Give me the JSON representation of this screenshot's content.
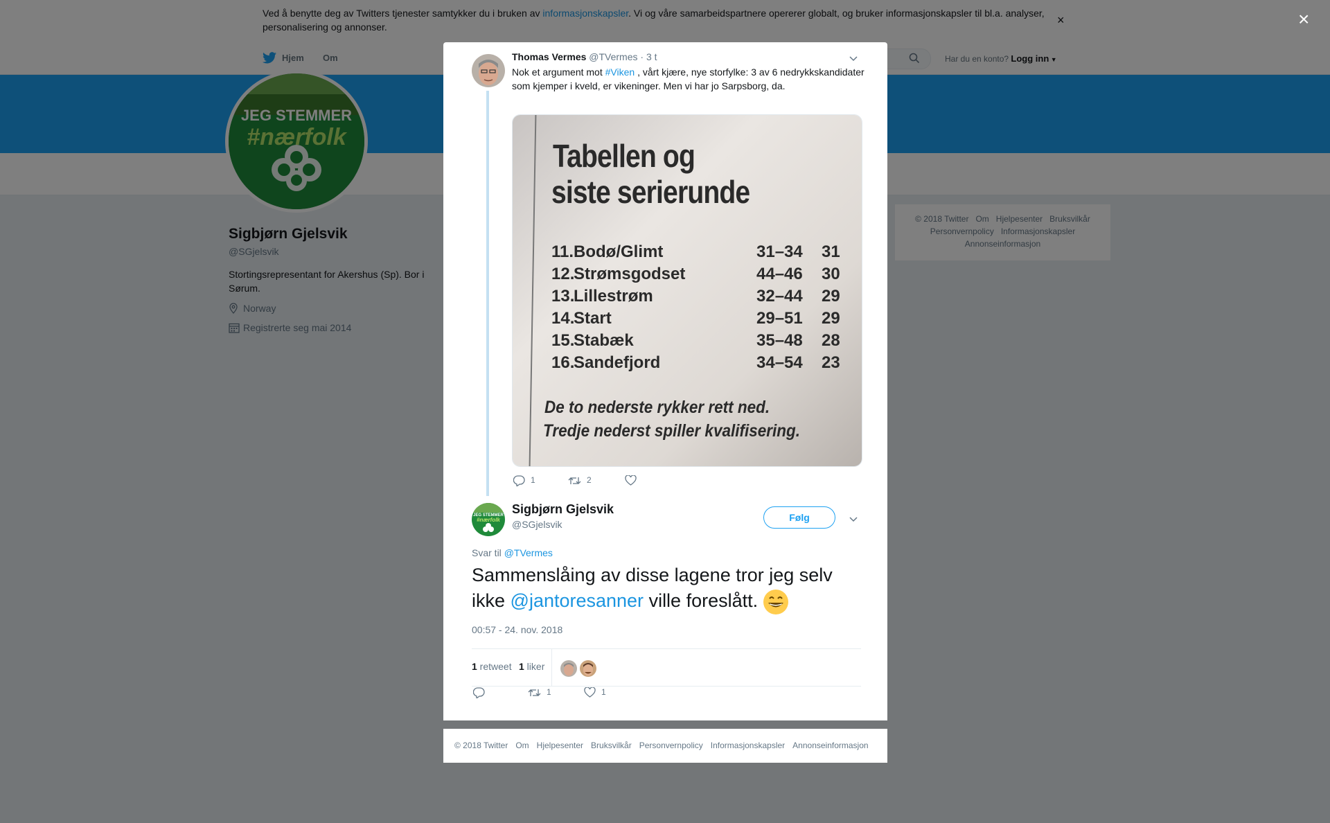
{
  "cookie_banner": {
    "text_before": "Ved å benytte deg av Twitters tjenester samtykker du i bruken av ",
    "link": "informasjonskapsler",
    "text_after": ". Vi og våre samarbeidspartnere opererer globalt, og bruker informasjonskapsler til bl.a. analyser, personalisering og annonser.",
    "close_label": "×"
  },
  "nav": {
    "home": "Hjem",
    "about": "Om",
    "login_prompt": "Har du en konto?",
    "login": "Logg inn"
  },
  "profile": {
    "name": "Sigbjørn Gjelsvik",
    "handle": "@SGjelsvik",
    "bio": "Stortingsrepresentant for Akershus (Sp). Bor i Sørum.",
    "location": "Norway",
    "joined": "Registrerte seg mai 2014",
    "avatar_text_1": "JEG STEMMER",
    "avatar_text_2": "#nærfolk"
  },
  "side_footer": {
    "items": [
      "© 2018 Twitter",
      "Om",
      "Hjelpesenter",
      "Bruksvilkår",
      "Personvernpolicy",
      "Informasjonskapsler",
      "Annonseinformasjon"
    ]
  },
  "overlay_close": "×",
  "tweet1": {
    "name": "Thomas Vermes",
    "handle": "@TVermes",
    "time": "· 3 t",
    "text_before": "Nok et argument mot ",
    "hashtag": "#Viken",
    "text_after": " , vårt kjære, nye storfylke: 3 av 6 nedrykkskandidater som kjemper i kveld,  er vikeninger. Men vi har jo Sarpsborg, da.",
    "replies": "1",
    "retweets": "2",
    "likes": "",
    "image": {
      "title_1": "Tabellen og",
      "title_2": "siste serierunde",
      "rows": [
        {
          "pos": "11.",
          "team": "Bodø/Glimt",
          "goals": "31–34",
          "pts": "31"
        },
        {
          "pos": "12.",
          "team": "Strømsgodset",
          "goals": "44–46",
          "pts": "30"
        },
        {
          "pos": "13.",
          "team": "Lillestrøm",
          "goals": "32–44",
          "pts": "29"
        },
        {
          "pos": "14.",
          "team": "Start",
          "goals": "29–51",
          "pts": "29"
        },
        {
          "pos": "15.",
          "team": "Stabæk",
          "goals": "35–48",
          "pts": "28"
        },
        {
          "pos": "16.",
          "team": "Sandefjord",
          "goals": "34–54",
          "pts": "23"
        }
      ],
      "note_1": "De to nederste rykker rett ned.",
      "note_2": "Tredje nederst spiller kvalifisering."
    }
  },
  "tweet2": {
    "name": "Sigbjørn Gjelsvik",
    "handle": "@SGjelsvik",
    "follow": "Følg",
    "reply_label": "Svar til ",
    "reply_handle": "@TVermes",
    "text_before": "Sammenslåing av disse lagene tror jeg selv ikke ",
    "mention": "@jantoresanner",
    "text_after": " ville foreslått. ",
    "timestamp": "00:57 - 24. nov. 2018",
    "retweet_count": "1",
    "retweet_label": " retweet",
    "like_count": "1",
    "like_label": " liker",
    "action_retweets": "1",
    "action_likes": "1"
  },
  "modal_footer": {
    "items": [
      "© 2018 Twitter",
      "Om",
      "Hjelpesenter",
      "Bruksvilkår",
      "Personvernpolicy",
      "Informasjonskapsler",
      "Annonseinformasjon"
    ]
  },
  "colors": {
    "accent": "#1da1f2",
    "link": "#1b95e0",
    "muted": "#657786",
    "green": "#1f8a3a"
  }
}
